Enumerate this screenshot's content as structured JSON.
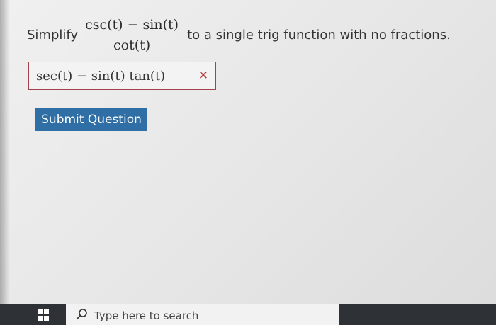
{
  "question": {
    "prompt_before": "Simplify",
    "numerator": "csc(t) − sin(t)",
    "denominator": "cot(t)",
    "prompt_after": "to a single trig function with no fractions."
  },
  "answer": {
    "value": "sec(t) − sin(t) tan(t)",
    "status_icon": "x-mark",
    "status_color": "#b23a3a"
  },
  "submit": {
    "label": "Submit Question",
    "color": "#2f6fa6"
  },
  "taskbar": {
    "start_icon": "windows-logo-icon",
    "search_icon": "search-icon",
    "search_placeholder": "Type here to search"
  }
}
